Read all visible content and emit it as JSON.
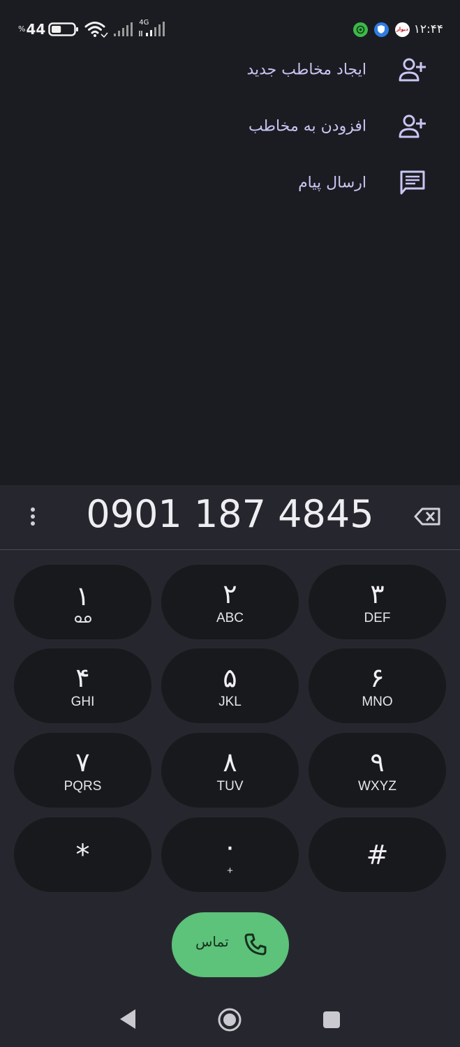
{
  "status_bar": {
    "battery_percent": "44",
    "battery_sign": "%",
    "battery_level": 0.44,
    "network_type": "4G",
    "time": "۱۲:۴۴",
    "notification_icons": [
      "green-app-icon",
      "blue-shield-app-icon",
      "divar-app-icon"
    ],
    "divar_icon_text": "دیوار"
  },
  "menu": {
    "items": [
      {
        "label": "ایجاد مخاطب جدید",
        "icon": "person-add-icon"
      },
      {
        "label": "افزودن به مخاطب",
        "icon": "person-add-icon"
      },
      {
        "label": "ارسال پیام",
        "icon": "message-icon"
      }
    ]
  },
  "dialpad": {
    "number": "0901 187 4845",
    "keys": [
      {
        "digit": "۱",
        "letters": "",
        "sub_icon": "voicemail-icon"
      },
      {
        "digit": "۲",
        "letters": "ABC"
      },
      {
        "digit": "۳",
        "letters": "DEF"
      },
      {
        "digit": "۴",
        "letters": "GHI"
      },
      {
        "digit": "۵",
        "letters": "JKL"
      },
      {
        "digit": "۶",
        "letters": "MNO"
      },
      {
        "digit": "۷",
        "letters": "PQRS"
      },
      {
        "digit": "۸",
        "letters": "TUV"
      },
      {
        "digit": "۹",
        "letters": "WXYZ"
      },
      {
        "digit": "*",
        "letters": ""
      },
      {
        "digit": "۰",
        "letters": "+"
      },
      {
        "digit": "#",
        "letters": ""
      }
    ],
    "call_label": "تماس"
  },
  "colors": {
    "background": "#1b1c21",
    "panel": "#26272e",
    "key": "#18191d",
    "accent_text": "#c8c6f4",
    "call_button": "#5dc27a"
  }
}
